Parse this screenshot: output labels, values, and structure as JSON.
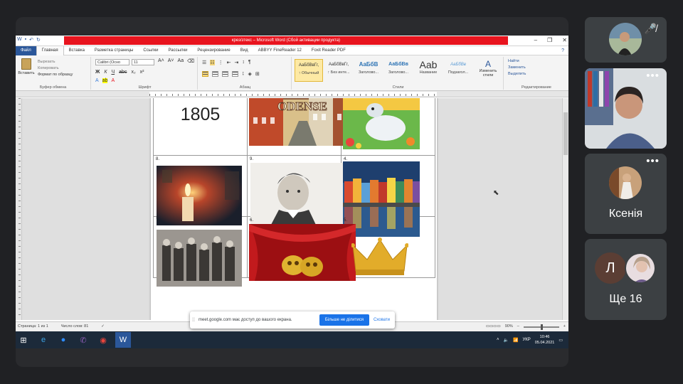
{
  "word": {
    "title": "крез/зтекс – Microsoft Word (Сбой активации продукта)",
    "tabs": [
      "Файл",
      "Главная",
      "Вставка",
      "Разметка страницы",
      "Ссылки",
      "Рассылки",
      "Рецензирование",
      "Вид",
      "ABBYY FineReader 12",
      "Foxit Reader PDF"
    ],
    "clipboard": {
      "paste": "Вставить",
      "cut": "Вырезать",
      "copy": "Копировать",
      "format": "Формат по образцу",
      "label": "Буфер обмена"
    },
    "font": {
      "name": "Calibri (Осно",
      "size": "11",
      "label": "Шрифт"
    },
    "paragraph": {
      "label": "Абзац"
    },
    "styles": {
      "label": "Стили",
      "items": [
        {
          "sample": "АаБбВвГг,",
          "name": "↑ Обычный"
        },
        {
          "sample": "АаБбВвГг,",
          "name": "↑ Без инте..."
        },
        {
          "sample": "АаБбВ",
          "name": "Заголово..."
        },
        {
          "sample": "АаБбВв",
          "name": "Заголово..."
        },
        {
          "sample": "Aab",
          "name": "Название"
        },
        {
          "sample": "АаБбВв",
          "name": "Подзагол..."
        }
      ],
      "change": "Изменить стили"
    },
    "editing": {
      "find": "Найти",
      "replace": "Заменить",
      "select": "Выделить",
      "label": "Редактирование"
    },
    "document": {
      "year": "1805",
      "odense": "ODENSE",
      "cell_numbers": [
        "8.",
        "9.",
        "4.",
        "7.",
        "6.",
        "5."
      ]
    },
    "status": {
      "page": "Страница: 1 из 1",
      "words": "Число слов: 81",
      "zoom": "90%"
    }
  },
  "share_bar": {
    "message": "meet.google.com має доступ до вашого екрана.",
    "stop": "Більше не ділитися",
    "hide": "Сховати"
  },
  "taskbar": {
    "lang": "УКР",
    "time": "10:46",
    "date": "05.04.2021"
  },
  "participants": [
    {
      "name": ""
    },
    {
      "name": ""
    },
    {
      "name": "Ксенія"
    },
    {
      "letter": "Л",
      "name": "Ще 16"
    }
  ]
}
